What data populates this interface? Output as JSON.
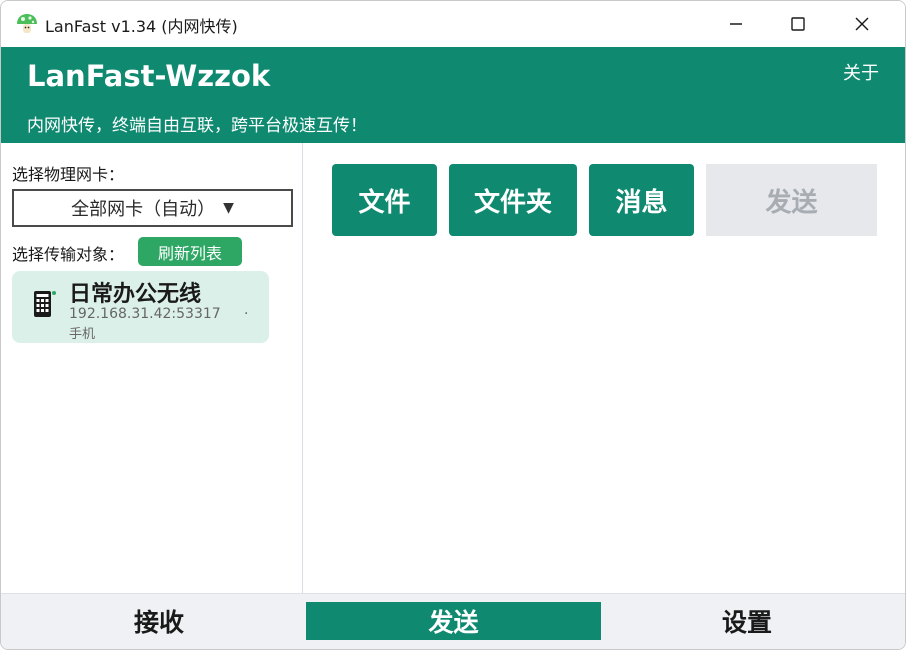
{
  "window": {
    "title": "LanFast v1.34 (内网快传)",
    "app_icon": "mushroom-icon",
    "controls": [
      "minimize-icon",
      "maximize-icon",
      "close-icon"
    ]
  },
  "header": {
    "title": "LanFast-Wzzok",
    "subtitle": "内网快传，终端自由互联，跨平台极速互传！",
    "about": "关于"
  },
  "left": {
    "nic_label": "选择物理网卡：",
    "nic_selected": "全部网卡（自动）",
    "nic_caret": "▼",
    "target_label": "选择传输对象：",
    "refresh_label": "刷新列表",
    "devices": [
      {
        "name": "日常办公无线",
        "address": "192.168.31.42:53317",
        "separator": "·",
        "type": "手机",
        "icon": "phone-icon"
      }
    ]
  },
  "actions": {
    "file": "文件",
    "folder": "文件夹",
    "message": "消息",
    "send": "发送"
  },
  "nav": {
    "receive": "接收",
    "send": "发送",
    "settings": "设置",
    "active": "send"
  },
  "colors": {
    "primary": "#0f8a70",
    "refresh": "#2ea664",
    "card_bg": "#dcf0ea",
    "disabled_bg": "#e6e8ec",
    "disabled_text": "#a8acb3",
    "nav_bg": "#eff1f4"
  }
}
